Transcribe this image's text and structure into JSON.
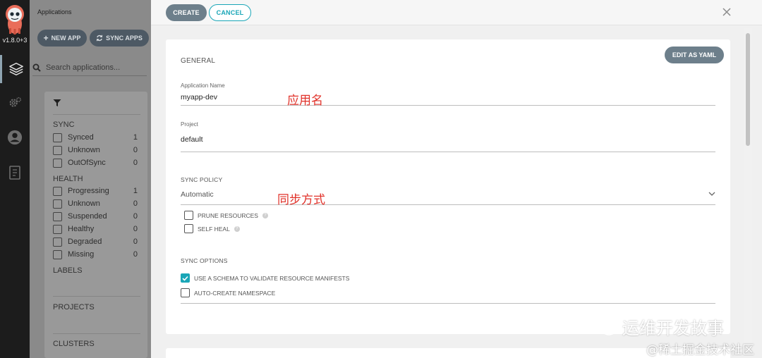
{
  "rail": {
    "version": "v1.8.0+3",
    "items": [
      {
        "icon": "layers-icon"
      },
      {
        "icon": "gear-icon"
      },
      {
        "icon": "user-icon"
      },
      {
        "icon": "docs-icon"
      }
    ]
  },
  "applications": {
    "title": "Applications",
    "new_app_label": "NEW APP",
    "sync_apps_label": "SYNC APPS",
    "search_placeholder": "Search applications..."
  },
  "filters": {
    "sync": {
      "title": "SYNC",
      "items": [
        {
          "label": "Synced",
          "count": "1"
        },
        {
          "label": "Unknown",
          "count": "0"
        },
        {
          "label": "OutOfSync",
          "count": "0"
        }
      ]
    },
    "health": {
      "title": "HEALTH",
      "items": [
        {
          "label": "Progressing",
          "count": "1"
        },
        {
          "label": "Unknown",
          "count": "0"
        },
        {
          "label": "Suspended",
          "count": "0"
        },
        {
          "label": "Healthy",
          "count": "0"
        },
        {
          "label": "Degraded",
          "count": "0"
        },
        {
          "label": "Missing",
          "count": "0"
        }
      ]
    },
    "labels_title": "LABELS",
    "projects_title": "PROJECTS",
    "clusters_title": "CLUSTERS"
  },
  "panel": {
    "create_label": "CREATE",
    "cancel_label": "CANCEL",
    "edit_yaml_label": "EDIT AS YAML",
    "general_title": "GENERAL",
    "app_name_label": "Application Name",
    "app_name_value": "myapp-dev",
    "project_label": "Project",
    "project_value": "default",
    "sync_policy_title": "SYNC POLICY",
    "sync_policy_value": "Automatic",
    "prune_label": "PRUNE RESOURCES",
    "prune_checked": false,
    "self_heal_label": "SELF HEAL",
    "self_heal_checked": false,
    "sync_options_title": "SYNC OPTIONS",
    "schema_label": "USE A SCHEMA TO VALIDATE RESOURCE MANIFESTS",
    "schema_checked": true,
    "auto_ns_label": "AUTO-CREATE NAMESPACE",
    "auto_ns_checked": false
  },
  "annotations": {
    "app_name_note": "应用名",
    "sync_policy_note": "同步方式"
  },
  "watermarks": {
    "wechat": "运维开发故事",
    "juejin": "@稀土掘金技术社区"
  },
  "colors": {
    "accent": "#1aa6b7",
    "button_gray": "#6d7f8b",
    "annotation_red": "#e1322a"
  }
}
